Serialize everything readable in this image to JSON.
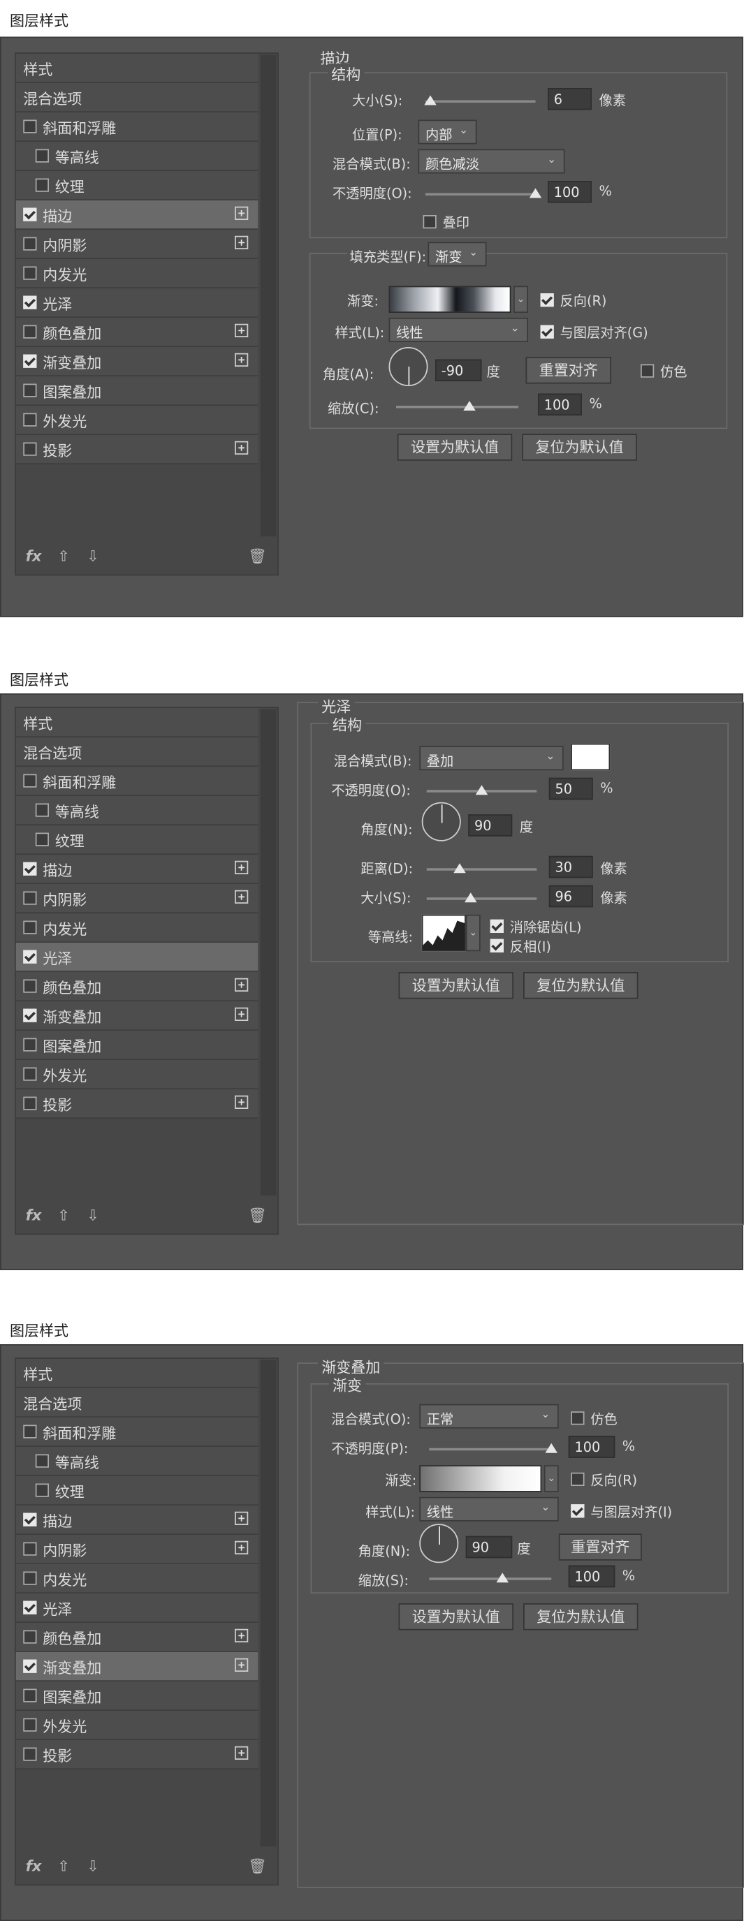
{
  "dialog_title": "图层样式",
  "sidebar": {
    "header": "样式",
    "blend": "混合选项",
    "items": [
      {
        "label": "斜面和浮雕",
        "plus": false,
        "sub": false
      },
      {
        "label": "等高线",
        "plus": false,
        "sub": true
      },
      {
        "label": "纹理",
        "plus": false,
        "sub": true
      },
      {
        "label": "描边",
        "plus": true,
        "sub": false
      },
      {
        "label": "内阴影",
        "plus": true,
        "sub": false
      },
      {
        "label": "内发光",
        "plus": false,
        "sub": false
      },
      {
        "label": "光泽",
        "plus": false,
        "sub": false
      },
      {
        "label": "颜色叠加",
        "plus": true,
        "sub": false
      },
      {
        "label": "渐变叠加",
        "plus": true,
        "sub": false
      },
      {
        "label": "图案叠加",
        "plus": false,
        "sub": false
      },
      {
        "label": "外发光",
        "plus": false,
        "sub": false
      },
      {
        "label": "投影",
        "plus": true,
        "sub": false
      }
    ],
    "checked": [
      false,
      false,
      false,
      true,
      false,
      false,
      true,
      false,
      true,
      false,
      false,
      false
    ],
    "footer": {
      "fx": "fx",
      "up": "⇧",
      "down": "⇩",
      "trash": "🗑"
    }
  },
  "dialogs": [
    {
      "selected": 3,
      "panel_title": "描边",
      "structure_title": "结构",
      "size_label": "大小(S):",
      "size_value": "6",
      "size_unit": "像素",
      "size_pos": 0.02,
      "position_label": "位置(P):",
      "position_value": "内部",
      "blend_label": "混合模式(B):",
      "blend_value": "颜色减淡",
      "opacity_label": "不透明度(O):",
      "opacity_value": "100",
      "opacity_unit": "%",
      "opacity_pos": 1.0,
      "overprint_label": "叠印",
      "fill_type_label": "填充类型(F):",
      "fill_type_value": "渐变",
      "gradient_label": "渐变:",
      "reverse_label": "反向(R)",
      "style_label": "样式(L):",
      "style_value": "线性",
      "align_label": "与图层对齐(G)",
      "angle_label": "角度(A):",
      "angle_value": "-90",
      "angle_unit": "度",
      "reset_align": "重置对齐",
      "dither_label": "仿色",
      "scale_label": "缩放(C):",
      "scale_value": "100",
      "scale_unit": "%",
      "scale_pos": 0.6,
      "btn_default": "设置为默认值",
      "btn_reset": "复位为默认值"
    },
    {
      "selected": 6,
      "panel_title": "光泽",
      "structure_title": "结构",
      "blend_label": "混合模式(B):",
      "blend_value": "叠加",
      "opacity_label": "不透明度(O):",
      "opacity_value": "50",
      "opacity_unit": "%",
      "opacity_pos": 0.5,
      "angle_label": "角度(N):",
      "angle_value": "90",
      "angle_unit": "度",
      "distance_label": "距离(D):",
      "distance_value": "30",
      "distance_unit": "像素",
      "distance_pos": 0.3,
      "size_label": "大小(S):",
      "size_value": "96",
      "size_unit": "像素",
      "size_pos": 0.4,
      "contour_label": "等高线:",
      "antialias_label": "消除锯齿(L)",
      "invert_label": "反相(I)",
      "btn_default": "设置为默认值",
      "btn_reset": "复位为默认值"
    },
    {
      "selected": 8,
      "panel_title": "渐变叠加",
      "gradient_title": "渐变",
      "blend_label": "混合模式(O):",
      "blend_value": "正常",
      "dither_label": "仿色",
      "opacity_label": "不透明度(P):",
      "opacity_value": "100",
      "opacity_unit": "%",
      "opacity_pos": 1.0,
      "gradient_label": "渐变:",
      "reverse_label": "反向(R)",
      "style_label": "样式(L):",
      "style_value": "线性",
      "align_label": "与图层对齐(I)",
      "angle_label": "角度(N):",
      "angle_value": "90",
      "angle_unit": "度",
      "reset_align": "重置对齐",
      "scale_label": "缩放(S):",
      "scale_value": "100",
      "scale_unit": "%",
      "scale_pos": 0.6,
      "btn_default": "设置为默认值",
      "btn_reset": "复位为默认值"
    }
  ]
}
